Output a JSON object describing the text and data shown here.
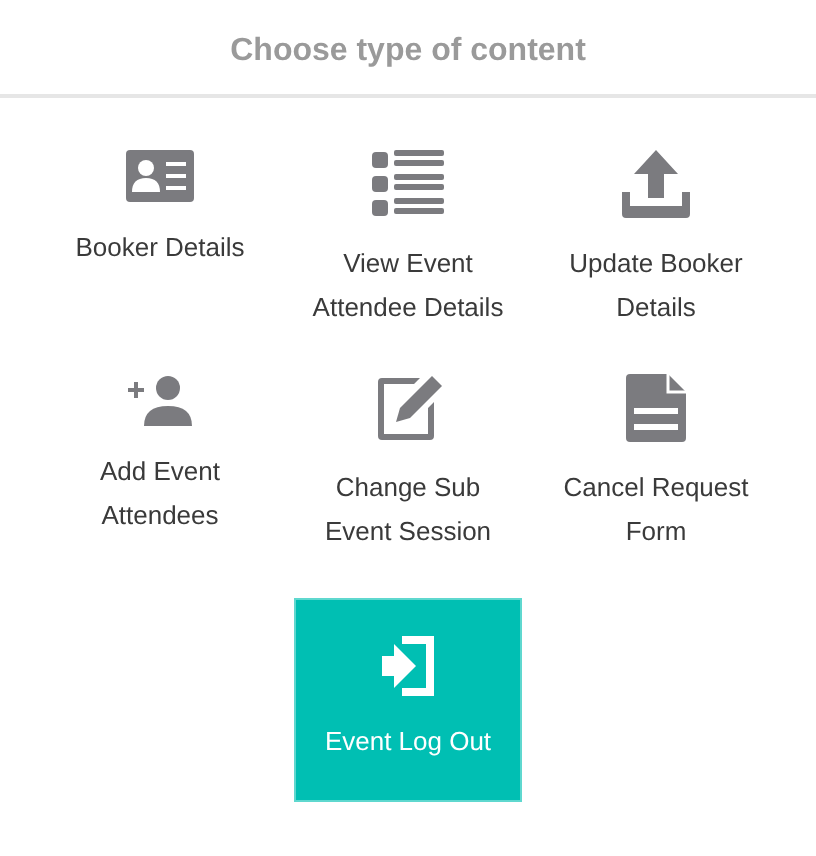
{
  "title": "Choose type of content",
  "tiles": [
    {
      "kind": "id-card",
      "label": "Booker Details",
      "selected": false
    },
    {
      "kind": "list",
      "label": "View Event Attendee Details",
      "selected": false
    },
    {
      "kind": "upload",
      "label": "Update Booker Details",
      "selected": false
    },
    {
      "kind": "add-person",
      "label": "Add Event Attendees",
      "selected": false
    },
    {
      "kind": "edit",
      "label": "Change Sub Event Session",
      "selected": false
    },
    {
      "kind": "document",
      "label": "Cancel Request Form",
      "selected": false
    },
    {
      "kind": "sign-in",
      "label": "Event Log Out",
      "selected": true
    }
  ]
}
